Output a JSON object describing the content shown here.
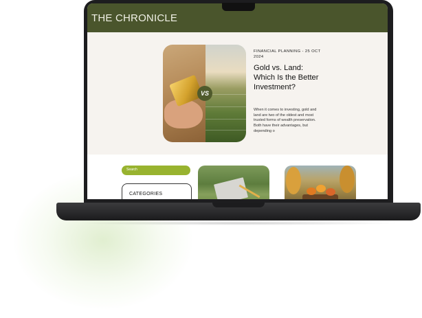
{
  "site": {
    "title": "THE CHRONICLE"
  },
  "featured": {
    "meta": "FINANCIAL PLANNING - 25 OCT 2024",
    "headline": "Gold vs. Land: Which Is the Better Investment?",
    "excerpt": "When it comes to investing, gold and land are two of the oldest and most trusted forms of wealth preservation. Both have their advantages, but depending o",
    "image_badge": "VS"
  },
  "sidebar": {
    "search_placeholder": "Search",
    "categories_title": "CATEGORIES"
  },
  "colors": {
    "header_bg": "#4a552c",
    "accent_green": "#98b32f",
    "page_bg": "#f6f3ef",
    "laptop_body": "#1d1d1f"
  }
}
